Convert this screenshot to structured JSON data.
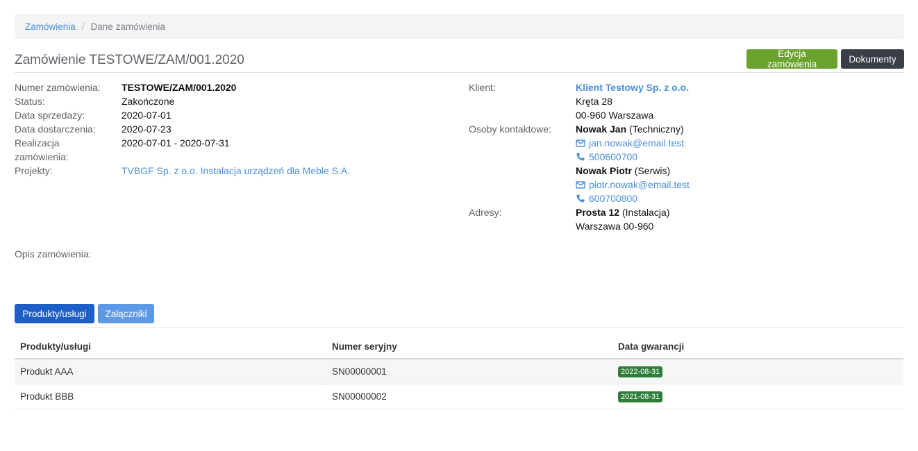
{
  "breadcrumb": {
    "parent": "Zamówienia",
    "separator": "/",
    "current": "Dane zamówienia"
  },
  "page": {
    "title": "Zamówienie TESTOWE/ZAM/001.2020"
  },
  "actions": {
    "edit": "Edycja zamówienia",
    "documents": "Dokumenty"
  },
  "details": {
    "number_label": "Numer zamówienia:",
    "number": "TESTOWE/ZAM/001.2020",
    "status_label": "Status:",
    "status": "Zakończone",
    "sale_date_label": "Data sprzedaży:",
    "sale_date": "2020-07-01",
    "delivery_date_label": "Data dostarczenia:",
    "delivery_date": "2020-07-23",
    "realization_label_1": "Realizacja",
    "realization_label_2": "zamówienia:",
    "realization": "2020-07-01 - 2020-07-31",
    "projects_label": "Projekty:",
    "project": "TVBGF Sp. z o.o. Instalacja urządzeń dla Meble S.A.",
    "description_label": "Opis zamówienia:"
  },
  "client": {
    "label": "Klient:",
    "name": "Klient Testowy Sp. z o.o.",
    "street": "Kręta 28",
    "city": "00-960 Warszawa",
    "contacts_label": "Osoby kontaktowe:",
    "contacts": [
      {
        "name": "Nowak Jan",
        "role": "(Techniczny)",
        "email": "jan.nowak@email.test",
        "phone": "500600700"
      },
      {
        "name": "Nowak Piotr",
        "role": "(Serwis)",
        "email": "piotr.nowak@email.test",
        "phone": "600700800"
      }
    ],
    "addresses_label": "Adresy:",
    "address_street": "Prosta 12",
    "address_type": "(Instalacja)",
    "address_city": "Warszawa 00-960"
  },
  "tabs": {
    "products": "Produkty/usługi",
    "attachments": "Załączniki"
  },
  "table": {
    "headers": [
      "Produkty/usługi",
      "Numer seryjny",
      "Data gwarancji"
    ],
    "rows": [
      {
        "product": "Produkt AAA",
        "serial": "SN00000001",
        "warranty": "2022-08-31"
      },
      {
        "product": "Produkt BBB",
        "serial": "SN00000002",
        "warranty": "2021-08-31"
      }
    ]
  },
  "colors": {
    "accent": "#4a8fd8",
    "edit_button": "#6ba22e",
    "docs_button": "#3a3e46",
    "tab_active": "#1e5fc7",
    "tab_inactive": "#5d9ae6",
    "badge": "#2e7d3a"
  }
}
